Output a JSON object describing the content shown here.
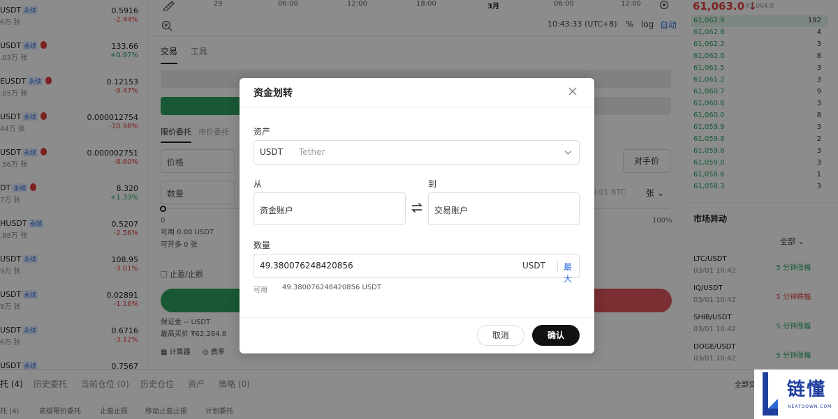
{
  "market_list": [
    {
      "symbol": "USDT",
      "tag": "永续",
      "fire": false,
      "volume": "6万 张",
      "price": "0.5916",
      "change": "-2.44%",
      "dir": "neg"
    },
    {
      "symbol": "USDT",
      "tag": "永续",
      "fire": true,
      "volume": ".03万 张",
      "price": "133.66",
      "change": "+0.97%",
      "dir": "pos"
    },
    {
      "symbol": "EUSDT",
      "tag": "永续",
      "fire": true,
      "volume": ".05万 张",
      "price": "0.12153",
      "change": "-9.47%",
      "dir": "neg"
    },
    {
      "symbol": "USDT",
      "tag": "永续",
      "fire": true,
      "volume": "44万 张",
      "price": "0.000012754",
      "change": "-10.98%",
      "dir": "neg"
    },
    {
      "symbol": "USDT",
      "tag": "永续",
      "fire": true,
      "volume": ".56万 张",
      "price": "0.000002751",
      "change": "-8.60%",
      "dir": "neg"
    },
    {
      "symbol": "DT",
      "tag": "永续",
      "fire": true,
      "volume": "7万 张",
      "price": "8.320",
      "change": "+1.33%",
      "dir": "pos"
    },
    {
      "symbol": "HUSDT",
      "tag": "永续",
      "fire": false,
      "volume": ".88万 张",
      "price": "0.5207",
      "change": "-2.56%",
      "dir": "neg"
    },
    {
      "symbol": "USDT",
      "tag": "永续",
      "fire": false,
      "volume": "9万 张",
      "price": "108.95",
      "change": "-3.01%",
      "dir": "neg"
    },
    {
      "symbol": "USDT",
      "tag": "永续",
      "fire": false,
      "volume": "9万 张",
      "price": "0.02891",
      "change": "-1.16%",
      "dir": "neg"
    },
    {
      "symbol": "USDT",
      "tag": "永续",
      "fire": false,
      "volume": "6万 张",
      "price": "0.6716",
      "change": "-3.12%",
      "dir": "neg"
    },
    {
      "symbol": "USDT",
      "tag": "永续",
      "fire": false,
      "volume": "",
      "price": "0.7567",
      "change": "",
      "dir": "neg"
    }
  ],
  "chart": {
    "ticks": [
      "29",
      "06:00",
      "12:00",
      "18:00",
      "3月",
      "06:00",
      "12:00"
    ],
    "time": "10:43:33 (UTC+8)",
    "pct": "%",
    "log": "log",
    "auto": "自动"
  },
  "trade": {
    "tab_trade": "交易",
    "tab_tools": "工具",
    "order_tab_limit": "限价委托",
    "order_tab_market": "市价委托",
    "price_label": "价格",
    "qty_label": "数量",
    "opponent": "对手价",
    "qty_hint": "0.01 BTC",
    "qty_unit": "张 ⌄",
    "slider_min": "0",
    "slider_max": "100%",
    "available": "可用 0.00 USDT",
    "openable": "可开多 0 张",
    "tpsl": "止盈/止损",
    "margin": "保证金 -- USDT",
    "max_buy": "最高买价 ₮62,284.8",
    "calculator": "计算器",
    "rate": "费率"
  },
  "order_book": {
    "last_price": "61,063.0 ↓",
    "mark_price": "61,064.8",
    "rows": [
      {
        "price": "61,062.9",
        "qty": "192"
      },
      {
        "price": "61,062.8",
        "qty": "4"
      },
      {
        "price": "61,062.2",
        "qty": "3"
      },
      {
        "price": "61,062.0",
        "qty": "8"
      },
      {
        "price": "61,061.5",
        "qty": "3"
      },
      {
        "price": "61,061.2",
        "qty": "3"
      },
      {
        "price": "61,060.7",
        "qty": "9"
      },
      {
        "price": "61,060.6",
        "qty": "3"
      },
      {
        "price": "61,060.0",
        "qty": "8"
      },
      {
        "price": "61,059.9",
        "qty": "3"
      },
      {
        "price": "61,059.8",
        "qty": "2"
      },
      {
        "price": "61,059.6",
        "qty": "3"
      },
      {
        "price": "61,059.0",
        "qty": "3"
      },
      {
        "price": "61,058.6",
        "qty": "1"
      },
      {
        "price": "61,058.3",
        "qty": "3"
      }
    ],
    "highlight_color": "#e4f4ea"
  },
  "anomaly": {
    "title": "市场异动",
    "filter": "全部 ⌄",
    "rows": [
      {
        "symbol": "LTC/USDT",
        "time": "03/01 10:42",
        "tag": "5 分钟涨幅",
        "dir": "pos"
      },
      {
        "symbol": "IQ/USDT",
        "time": "03/01 10:42",
        "tag": "5 分钟跌幅",
        "dir": "neg"
      },
      {
        "symbol": "SHIB/USDT",
        "time": "03/01 10:42",
        "tag": "5 分钟涨幅",
        "dir": "pos"
      },
      {
        "symbol": "DOGE/USDT",
        "time": "03/01 10:42",
        "tag": "5 分钟涨幅",
        "dir": "pos"
      }
    ]
  },
  "bottom": {
    "tabs": [
      "托 (4)",
      "历史委托",
      "当前仓位 (0)",
      "历史仓位",
      "资产",
      "策略 (0)"
    ],
    "subtabs": [
      "托 (4)",
      "高级限价委托",
      "止盈止损",
      "移动止盈止损",
      "计划委托"
    ],
    "all": "全部交"
  },
  "modal": {
    "title": "资金划转",
    "asset_label": "资产",
    "asset_code": "USDT",
    "asset_name": "Tether",
    "from_label": "从",
    "to_label": "到",
    "from_account": "资金账户",
    "to_account": "交易账户",
    "qty_label": "数量",
    "qty_value": "49.380076248420856",
    "qty_currency": "USDT",
    "max": "最大",
    "avail_label": "可用",
    "avail_value": "49.380076248420856 USDT",
    "cancel": "取消",
    "confirm": "确认"
  },
  "watermark": {
    "cn": "链懂",
    "en": "NEATDOWN.COM"
  },
  "colors": {
    "up": "#1fa35c",
    "down": "#e0413c",
    "accent": "#2f6ae0",
    "confirm_bg": "#111111"
  }
}
